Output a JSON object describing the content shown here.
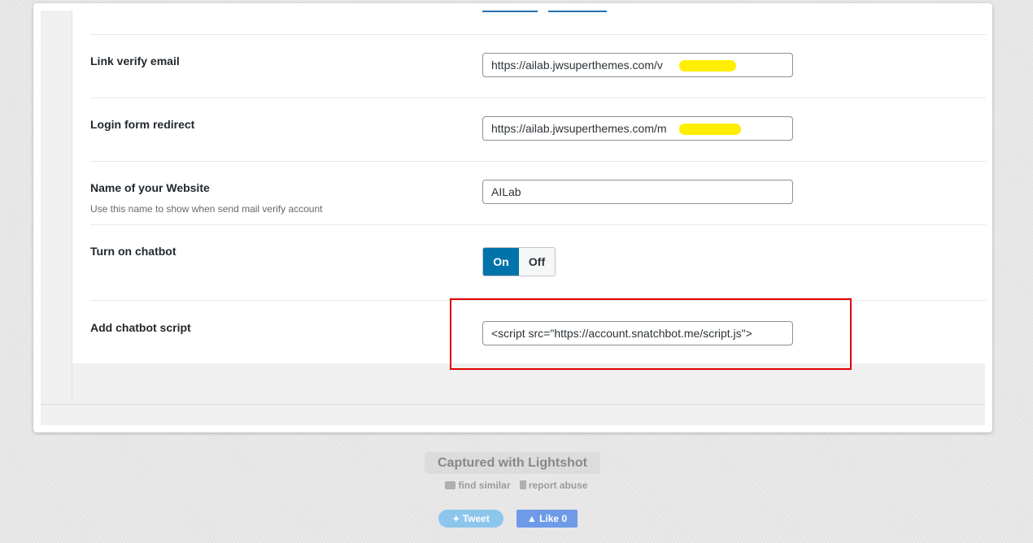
{
  "settings": {
    "link_verify_email": {
      "label": "Link verify email",
      "value": "https://ailab.jwsuperthemes.com/v"
    },
    "login_form_redirect": {
      "label": "Login form redirect",
      "value": "https://ailab.jwsuperthemes.com/m"
    },
    "website_name": {
      "label": "Name of your Website",
      "description": "Use this name to show when send mail verify account",
      "value": "AILab"
    },
    "chatbot_toggle": {
      "label": "Turn on chatbot",
      "on_label": "On",
      "off_label": "Off",
      "selected": "On"
    },
    "chatbot_script": {
      "label": "Add chatbot script",
      "value": "<script src=\"https://account.snatchbot.me/script.js\">"
    }
  },
  "lightshot": {
    "captured_label": "Captured with Lightshot",
    "find_similar": "find similar",
    "report_abuse": "report abuse",
    "tweet_label": "Tweet",
    "like_label": "Like 0"
  },
  "colors": {
    "accent": "#0073aa",
    "highlight_border": "#e00000",
    "redaction": "#ffee00"
  }
}
